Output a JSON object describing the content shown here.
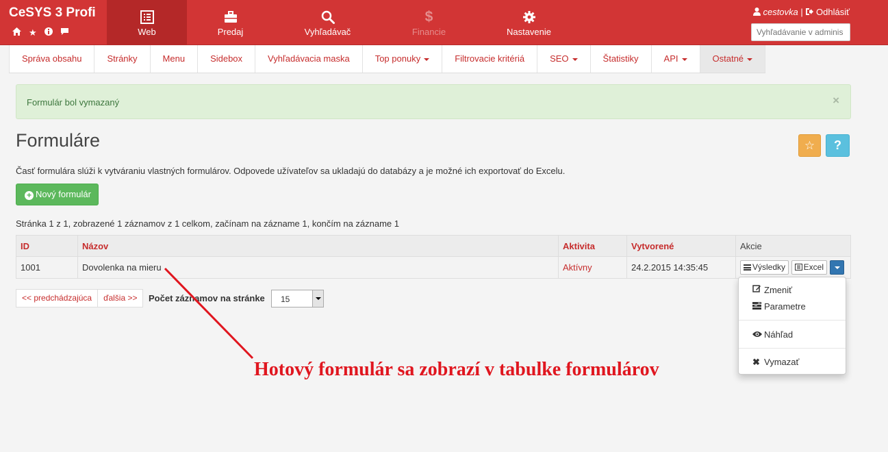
{
  "brand": {
    "title": "CeSYS 3 Profi",
    "icons": [
      "home-icon",
      "star-icon",
      "info-icon",
      "comment-icon"
    ]
  },
  "topnav": [
    {
      "label": "Web",
      "icon": "list-alt-icon",
      "active": true
    },
    {
      "label": "Predaj",
      "icon": "briefcase-icon"
    },
    {
      "label": "Vyhľadávač",
      "icon": "search-icon"
    },
    {
      "label": "Financie",
      "icon": "dollar-icon",
      "disabled": true
    },
    {
      "label": "Nastavenie",
      "icon": "gear-icon"
    }
  ],
  "user": {
    "name": "cestovka",
    "separator": "|",
    "logout": "Odhlásiť"
  },
  "admin_search": {
    "placeholder": "Vyhľadávanie v adminis"
  },
  "subnav": [
    {
      "label": "Správa obsahu"
    },
    {
      "label": "Stránky"
    },
    {
      "label": "Menu"
    },
    {
      "label": "Sidebox"
    },
    {
      "label": "Vyhľadávacia maska"
    },
    {
      "label": "Top ponuky",
      "caret": true
    },
    {
      "label": "Filtrovacie kritériá"
    },
    {
      "label": "SEO",
      "caret": true
    },
    {
      "label": "Štatistiky"
    },
    {
      "label": "API",
      "caret": true
    },
    {
      "label": "Ostatné",
      "caret": true,
      "active": true
    }
  ],
  "alert": {
    "text": "Formulár bol vymazaný",
    "close": "×"
  },
  "page": {
    "title": "Formuláre",
    "description": "Časť formulára slúži k vytváraniu vlastných formulárov. Odpovede užívateľov sa ukladajú do databázy a je možné ich exportovať do Excelu.",
    "new_button": "Nový formulár",
    "star_button": "☆",
    "help_button": "?",
    "info": "Stránka 1 z 1, zobrazené 1 záznamov z 1 celkom, začínam na zázname 1, končím na zázname 1"
  },
  "table": {
    "headers": {
      "id": "ID",
      "name": "Názov",
      "activity": "Aktivita",
      "created": "Vytvorené",
      "actions": "Akcie"
    },
    "rows": [
      {
        "id": "1001",
        "name": "Dovolenka na mieru",
        "activity": "Aktívny",
        "created": "24.2.2015 14:35:45",
        "btn_results": "Výsledky",
        "btn_excel": "Excel"
      }
    ]
  },
  "pagination": {
    "prev": "<< predchádzajúca",
    "next": "ďalšia >>",
    "per_page_label": "Počet záznamov na stránke",
    "per_page_value": "15"
  },
  "dropdown": {
    "edit": "Zmeniť",
    "params": "Parametre",
    "preview": "Náhľad",
    "delete": "Vymazať"
  },
  "annotation": {
    "text": "Hotový formulár sa zobrazí v tabulke formulárov",
    "color": "#e0161f"
  },
  "colors": {
    "header_red": "#d23535",
    "link_red": "#c62c2c",
    "success_green": "#5cb85c"
  }
}
